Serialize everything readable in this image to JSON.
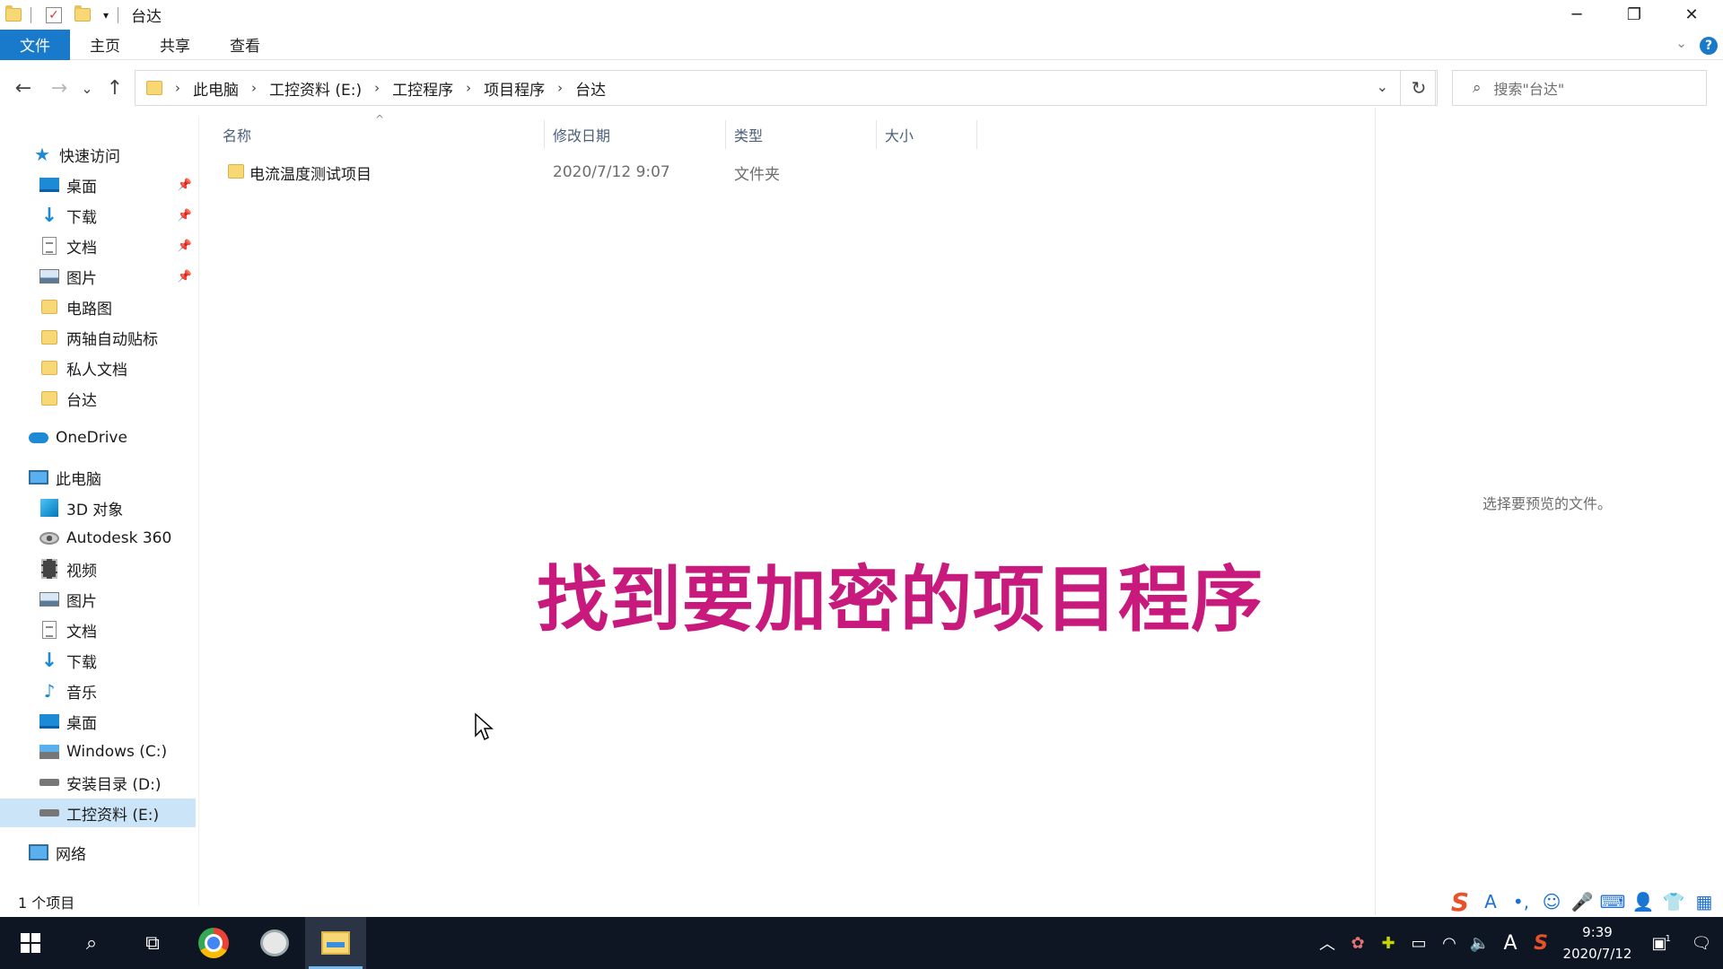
{
  "window": {
    "title": "台达",
    "minimize": "─",
    "restore": "❐",
    "close": "✕"
  },
  "ribbon": {
    "tabs": [
      "文件",
      "主页",
      "共享",
      "查看"
    ],
    "help": "?"
  },
  "nav": {
    "back": "←",
    "forward": "→",
    "recent": "⌄",
    "up": "↑",
    "breadcrumb": [
      "此电脑",
      "工控资料 (E:)",
      "工控程序",
      "项目程序",
      "台达"
    ],
    "refresh": "↻",
    "search_placeholder": "搜索\"台达\""
  },
  "sidebar": {
    "quick_access": "快速访问",
    "quick_items": [
      {
        "label": "桌面",
        "icon": "desktop-icon",
        "pinned": true
      },
      {
        "label": "下载",
        "icon": "download-icon",
        "pinned": true
      },
      {
        "label": "文档",
        "icon": "document-icon",
        "pinned": true
      },
      {
        "label": "图片",
        "icon": "pictures-icon",
        "pinned": true
      },
      {
        "label": "电路图",
        "icon": "folder-icon",
        "pinned": false
      },
      {
        "label": "两轴自动贴标",
        "icon": "folder-icon",
        "pinned": false
      },
      {
        "label": "私人文档",
        "icon": "folder-icon",
        "pinned": false
      },
      {
        "label": "台达",
        "icon": "folder-icon",
        "pinned": false
      }
    ],
    "onedrive": "OneDrive",
    "this_pc": "此电脑",
    "pc_items": [
      {
        "label": "3D 对象",
        "icon": "3d-objects-icon"
      },
      {
        "label": "Autodesk 360",
        "icon": "autodesk-icon"
      },
      {
        "label": "视频",
        "icon": "video-icon"
      },
      {
        "label": "图片",
        "icon": "pictures-icon"
      },
      {
        "label": "文档",
        "icon": "document-icon"
      },
      {
        "label": "下载",
        "icon": "download-icon"
      },
      {
        "label": "音乐",
        "icon": "music-icon"
      },
      {
        "label": "桌面",
        "icon": "desktop-icon"
      },
      {
        "label": "Windows (C:)",
        "icon": "drive-c-icon"
      },
      {
        "label": "安装目录 (D:)",
        "icon": "drive-icon"
      },
      {
        "label": "工控资料 (E:)",
        "icon": "drive-icon",
        "selected": true
      }
    ],
    "network": "网络"
  },
  "columns": {
    "name": "名称",
    "modified": "修改日期",
    "type": "类型",
    "size": "大小"
  },
  "files": [
    {
      "name": "电流温度测试项目",
      "modified": "2020/7/12 9:07",
      "type": "文件夹",
      "size": ""
    }
  ],
  "preview": {
    "empty_text": "选择要预览的文件。"
  },
  "caption": "找到要加密的项目程序",
  "status": {
    "item_count": "1 个项目"
  },
  "taskbar": {
    "time": "9:39",
    "date": "2020/7/12",
    "ime_letter": "A",
    "notification_badge": "1"
  },
  "colors": {
    "accent": "#1979ca",
    "caption": "#c8197c",
    "taskbar": "#0e1624",
    "selected": "#cce4f7"
  }
}
